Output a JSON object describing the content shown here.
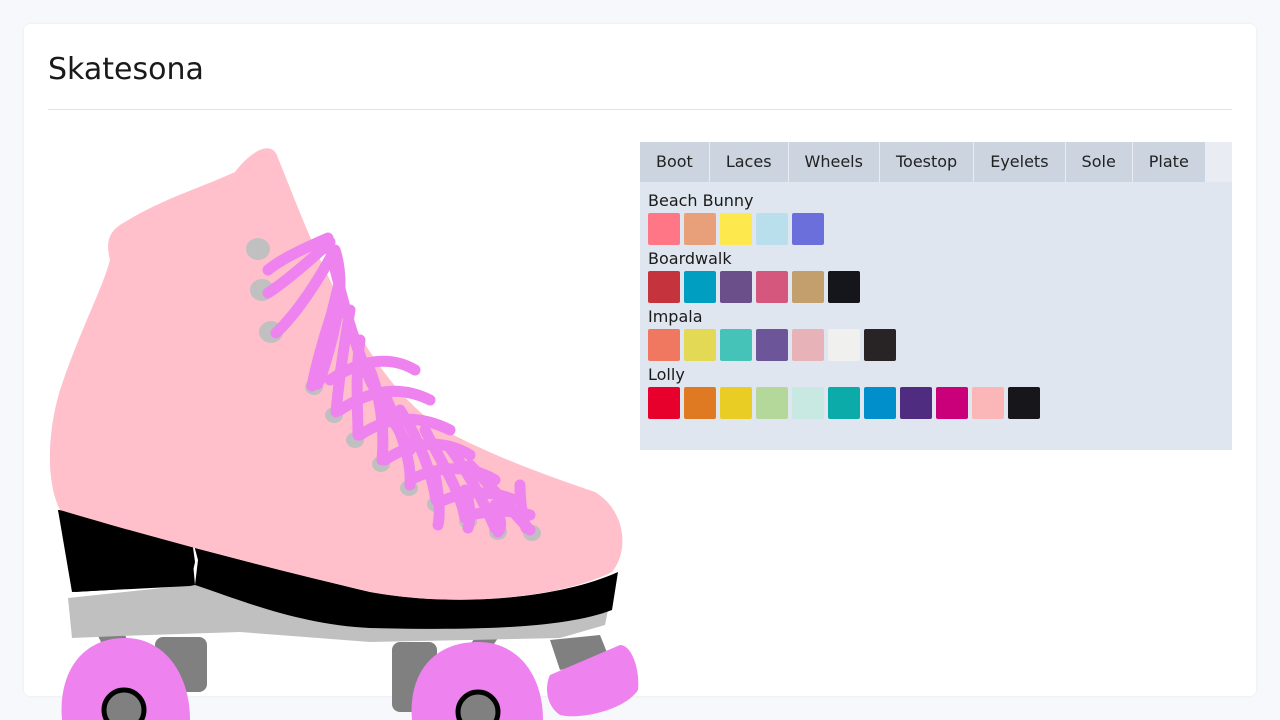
{
  "app": {
    "title": "Skatesona"
  },
  "tabs": [
    "Boot",
    "Laces",
    "Wheels",
    "Toestop",
    "Eyelets",
    "Sole",
    "Plate"
  ],
  "palettes": [
    {
      "name": "Beach Bunny",
      "colors": [
        "#ff7686",
        "#e8a07a",
        "#fde84e",
        "#b9dfec",
        "#6b6fdc"
      ]
    },
    {
      "name": "Boardwalk",
      "colors": [
        "#c5343d",
        "#009fc2",
        "#6b4f8b",
        "#d5577e",
        "#c39f6e",
        "#14161b"
      ]
    },
    {
      "name": "Impala",
      "colors": [
        "#f07760",
        "#e4d954",
        "#45c3b8",
        "#6c5699",
        "#e7b2b8",
        "#f0f0ee",
        "#282324"
      ]
    },
    {
      "name": "Lolly",
      "colors": [
        "#e8002d",
        "#e07a22",
        "#e9cd25",
        "#b4d79a",
        "#c8e9e2",
        "#0aaba8",
        "#008fca",
        "#4f2c7f",
        "#c9007a",
        "#fbb7b7",
        "#17171b"
      ]
    }
  ],
  "skate": {
    "boot_color": "#ffc0cb",
    "laces_color": "#ee82ee",
    "wheels_color": "#ee82ee",
    "toestop_color": "#ee82ee",
    "eyelets_color": "#c0c0c0",
    "sole_color": "#000000",
    "plate_color": "#c0c0c0",
    "truck_color": "#808080"
  }
}
